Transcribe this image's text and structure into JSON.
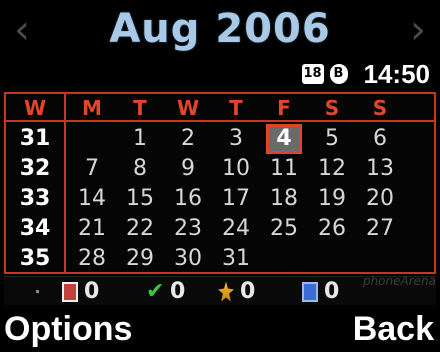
{
  "header": {
    "title": "Aug 2006",
    "prev_arrow": "‹",
    "next_arrow": "›"
  },
  "status": {
    "signal_icon_text": "18",
    "bluetooth_icon_text": "B",
    "time": "14:50"
  },
  "calendar": {
    "week_header": "W",
    "day_headers": [
      "M",
      "T",
      "W",
      "T",
      "F",
      "S",
      "S"
    ],
    "weeks": [
      {
        "num": "31",
        "days": [
          "",
          "1",
          "2",
          "3",
          "4",
          "5",
          "6"
        ]
      },
      {
        "num": "32",
        "days": [
          "7",
          "8",
          "9",
          "10",
          "11",
          "12",
          "13"
        ]
      },
      {
        "num": "33",
        "days": [
          "14",
          "15",
          "16",
          "17",
          "18",
          "19",
          "20"
        ]
      },
      {
        "num": "34",
        "days": [
          "21",
          "22",
          "23",
          "24",
          "25",
          "26",
          "27"
        ]
      },
      {
        "num": "35",
        "days": [
          "28",
          "29",
          "30",
          "31",
          "",
          "",
          ""
        ]
      }
    ],
    "today": "4",
    "accent_color": "#c8361c"
  },
  "summary": [
    {
      "icon": "memo-icon",
      "count": "0"
    },
    {
      "icon": "todo-icon",
      "count": "0"
    },
    {
      "icon": "anniversary-icon",
      "count": "0"
    },
    {
      "icon": "schedule-icon",
      "count": "0"
    }
  ],
  "softkeys": {
    "left": "Options",
    "right": "Back"
  },
  "watermark": "phoneArena"
}
